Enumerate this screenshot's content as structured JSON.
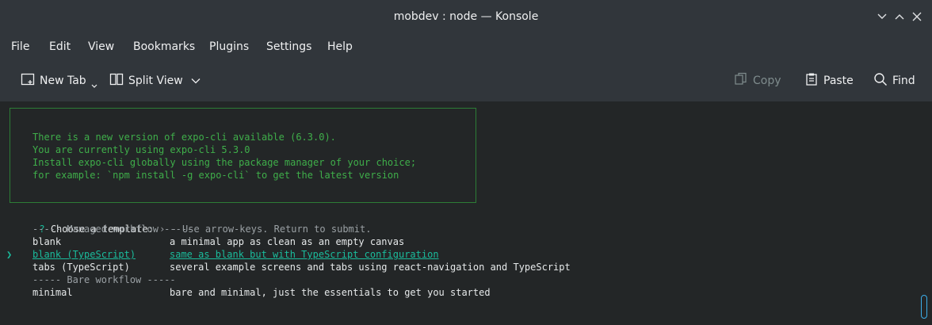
{
  "window": {
    "title": "mobdev : node — Konsole"
  },
  "menu": [
    "File",
    "Edit",
    "View",
    "Bookmarks",
    "Plugins",
    "Settings",
    "Help"
  ],
  "toolbar": {
    "new_tab": "New Tab",
    "split_view": "Split View",
    "copy": "Copy",
    "paste": "Paste",
    "find": "Find"
  },
  "notice": [
    "There is a new version of expo-cli available (6.3.0).",
    "You are currently using expo-cli 5.3.0",
    "Install expo-cli globally using the package manager of your choice;",
    "for example: `npm install -g expo-cli` to get the latest version"
  ],
  "prompt": {
    "q": "?",
    "question": "Choose a template:",
    "arrow": "›",
    "hint": "- Use arrow-keys. Return to submit."
  },
  "groups": {
    "managed": "----- Managed workflow -----",
    "bare": "----- Bare workflow -----"
  },
  "options": [
    {
      "name": "blank",
      "desc": "a minimal app as clean as an empty canvas"
    },
    {
      "name": "blank (TypeScript)",
      "desc": "same as blank but with TypeScript configuration"
    },
    {
      "name": "tabs (TypeScript)",
      "desc": "several example screens and tabs using react-navigation and TypeScript"
    },
    {
      "name": "minimal",
      "desc": "bare and minimal, just the essentials to get you started"
    }
  ],
  "cursor": "❯"
}
